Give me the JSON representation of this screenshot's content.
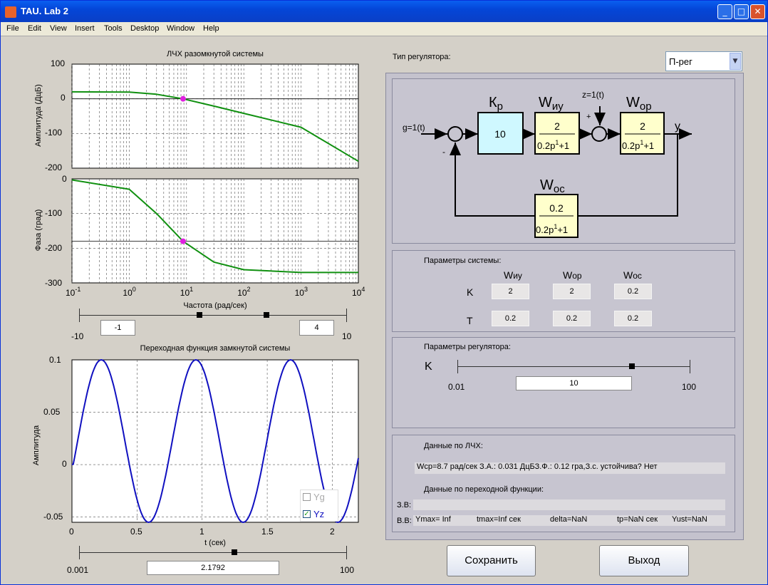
{
  "window": {
    "title": "TAU. Lab 2",
    "minimize": "_",
    "maximize": "□",
    "close": "✕"
  },
  "menu": [
    "File",
    "Edit",
    "View",
    "Insert",
    "Tools",
    "Desktop",
    "Window",
    "Help"
  ],
  "bode": {
    "title": "ЛЧХ разомкнутой системы",
    "amp_ylabel": "Амплитуда (ДцБ)",
    "phase_ylabel": "Фаза (град)",
    "xlabel": "Частота (рад/сек)",
    "amp_ticks": [
      "100",
      "0",
      "-100",
      "-200"
    ],
    "phase_ticks": [
      "0",
      "-100",
      "-200",
      "-300"
    ],
    "x_ticks": [
      {
        "b": "10",
        "e": "-1"
      },
      {
        "b": "10",
        "e": "0"
      },
      {
        "b": "10",
        "e": "1"
      },
      {
        "b": "10",
        "e": "2"
      },
      {
        "b": "10",
        "e": "3"
      },
      {
        "b": "10",
        "e": "4"
      }
    ],
    "slider": {
      "min_label": "-10",
      "max_label": "10",
      "low_value": "-1",
      "high_value": "4",
      "low": -1,
      "high": 4,
      "min": -10,
      "max": 10
    }
  },
  "step": {
    "title": "Переходная функция замкнутой системы",
    "ylabel": "Амплитуда",
    "xlabel": "t (сек)",
    "y_ticks": [
      "0.1",
      "0.05",
      "0",
      "-0.05"
    ],
    "x_ticks": [
      "0",
      "0.5",
      "1",
      "1.5",
      "2"
    ],
    "legend": {
      "yg": "Yg",
      "yz": "Yz",
      "yg_checked": false,
      "yz_checked": true
    },
    "slider": {
      "min_label": "0.001",
      "max_label": "100",
      "value": "2.1792",
      "fraction": 0.58
    }
  },
  "chart_data": [
    {
      "type": "line",
      "title": "ЛЧХ разомкнутой системы",
      "ylabel": "Амплитуда (ДцБ)",
      "xlabel": "Частота (рад/сек)",
      "x_scale": "log",
      "xlim": [
        0.1,
        10000
      ],
      "ylim": [
        -200,
        100
      ],
      "series": [
        {
          "x": [
            0.1,
            1,
            3,
            8.7,
            30,
            100,
            1000,
            10000
          ],
          "values": [
            20,
            19.5,
            13,
            0,
            -21,
            -42,
            -82,
            -180
          ]
        }
      ],
      "marker": {
        "x": 8.7,
        "y": 0
      }
    },
    {
      "type": "line",
      "ylabel": "Фаза (град)",
      "xlabel": "Частота (рад/сек)",
      "x_scale": "log",
      "xlim": [
        0.1,
        10000
      ],
      "ylim": [
        -300,
        0
      ],
      "series": [
        {
          "x": [
            0.1,
            1,
            3,
            8.7,
            30,
            100,
            1000,
            10000
          ],
          "values": [
            -3,
            -30,
            -100,
            -180,
            -240,
            -262,
            -270,
            -270
          ]
        }
      ],
      "marker": {
        "x": 8.7,
        "y": -180
      }
    },
    {
      "type": "line",
      "title": "Переходная функция замкнутой системы",
      "ylabel": "Амплитуда",
      "xlabel": "t (сек)",
      "xlim": [
        0,
        2.2
      ],
      "ylim": [
        -0.055,
        0.1
      ],
      "series": [
        {
          "name": "Yz",
          "x": [
            0,
            0.18,
            0.55,
            0.91,
            1.27,
            1.63,
            2.0,
            2.18
          ],
          "values": [
            0,
            0.1,
            -0.055,
            0.1,
            -0.055,
            0.1,
            -0.055,
            0.025
          ]
        }
      ]
    }
  ],
  "regulator": {
    "type_label": "Тип регулятора:",
    "selected": "П-рег"
  },
  "diagram": {
    "kp": "К",
    "kp_sub": "р",
    "kp_value": "10",
    "wiy": "W",
    "wiy_sub": "иу",
    "w_num": "2",
    "w_den": "0.2p",
    "w_den_exp": "1",
    "w_den_tail": "+1",
    "z": "z=1(t)",
    "wop": "W",
    "wop_sub": "ор",
    "y": "y",
    "g": "g=1(t)",
    "plus": "+",
    "minus": "-",
    "woc": "W",
    "woc_sub": "ос",
    "woc_num": "0.2"
  },
  "params": {
    "title": "Параметры системы:",
    "cols": [
      {
        "w": "W",
        "sub": "иу"
      },
      {
        "w": "W",
        "sub": "ор"
      },
      {
        "w": "W",
        "sub": "ос"
      }
    ],
    "row_k": "K",
    "row_t": "T",
    "k": [
      "2",
      "2",
      "0.2"
    ],
    "t": [
      "0.2",
      "0.2",
      "0.2"
    ]
  },
  "reg_params": {
    "title": "Параметры регулятора:",
    "k_label": "K",
    "min": "0.01",
    "max": "100",
    "value": "10",
    "fraction": 0.75
  },
  "lch": {
    "title": "Данные по ЛЧХ:",
    "text": "Wcp=8.7 рад/сек  З.А.:  0.031 ДцБЗ.Ф.:  0.12 гра,З.с.  устойчива?  Нет"
  },
  "step_data": {
    "title": "Данные по переходной функции:",
    "zv_label": "З.В:",
    "zv_text": "",
    "vv_label": "В.В:",
    "ymax": "Ymax= Inf",
    "tmax": "tmax=Inf сек",
    "delta": "delta=NaN",
    "tp": "tp=NaN сек",
    "yust": "Yust=NaN"
  },
  "buttons": {
    "save": "Сохранить",
    "exit": "Выход"
  },
  "colors": {
    "curve": "#109010",
    "marker": "#e020e0",
    "step": "#1010c0",
    "panel": "#c7c5d0",
    "block_kp": "#cff8ff",
    "block": "#ffffcc"
  }
}
